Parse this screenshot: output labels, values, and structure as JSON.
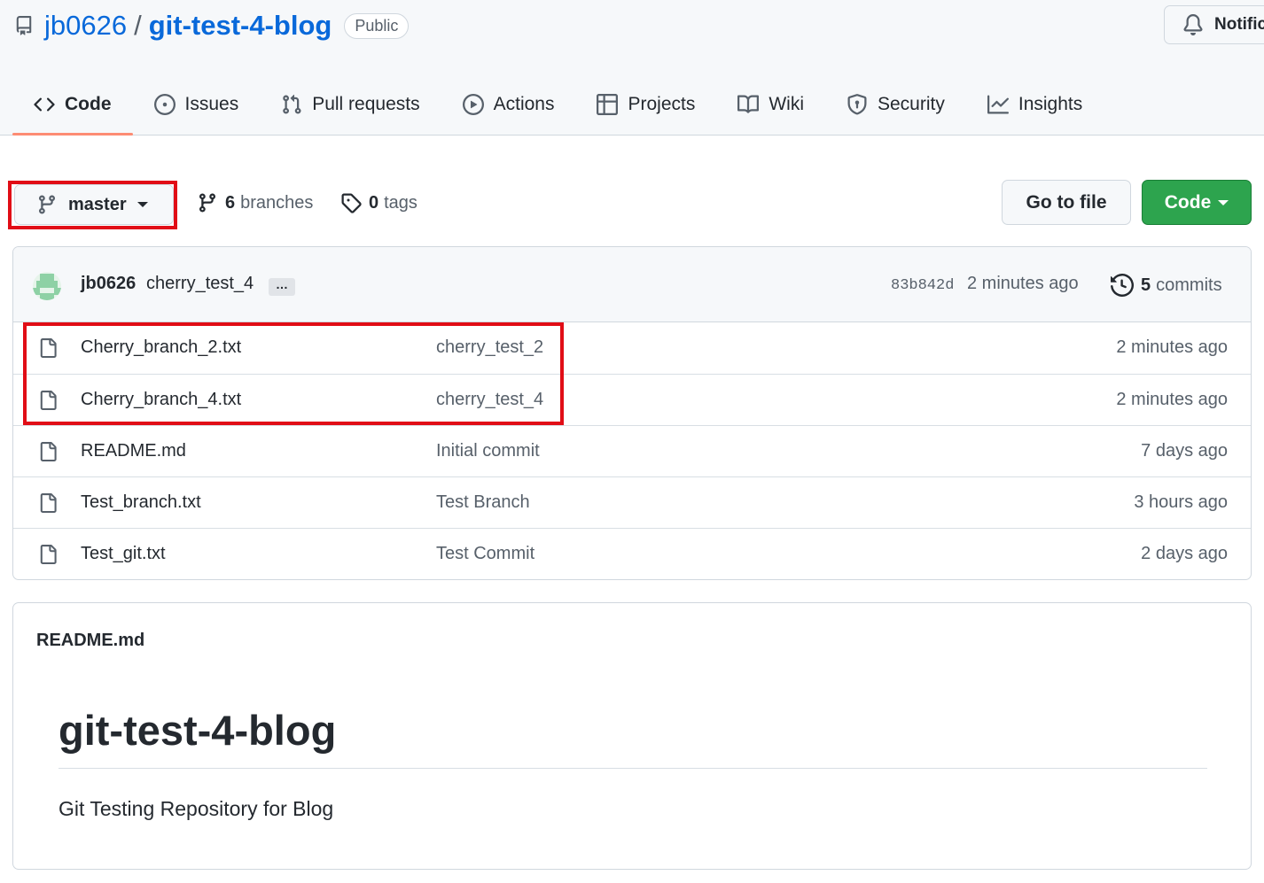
{
  "repo": {
    "owner": "jb0626",
    "separator": "/",
    "name": "git-test-4-blog",
    "visibility": "Public"
  },
  "header": {
    "notifications_label": "Notific"
  },
  "tabs": [
    {
      "label": "Code",
      "icon": "code-icon",
      "active": true
    },
    {
      "label": "Issues",
      "icon": "issue-circle-icon"
    },
    {
      "label": "Pull requests",
      "icon": "pull-request-icon"
    },
    {
      "label": "Actions",
      "icon": "play-circle-icon"
    },
    {
      "label": "Projects",
      "icon": "table-icon"
    },
    {
      "label": "Wiki",
      "icon": "book-icon"
    },
    {
      "label": "Security",
      "icon": "shield-icon"
    },
    {
      "label": "Insights",
      "icon": "graph-icon"
    }
  ],
  "toolbar": {
    "branch": "master",
    "branches_count": "6",
    "branches_label": "branches",
    "tags_count": "0",
    "tags_label": "tags",
    "go_to_file": "Go to file",
    "code_button": "Code"
  },
  "latest_commit": {
    "author": "jb0626",
    "message": "cherry_test_4",
    "more": "…",
    "sha": "83b842d",
    "time": "2 minutes ago",
    "commits_count": "5",
    "commits_label": "commits"
  },
  "files": [
    {
      "name": "Cherry_branch_2.txt",
      "message": "cherry_test_2",
      "age": "2 minutes ago"
    },
    {
      "name": "Cherry_branch_4.txt",
      "message": "cherry_test_4",
      "age": "2 minutes ago"
    },
    {
      "name": "README.md",
      "message": "Initial commit",
      "age": "7 days ago"
    },
    {
      "name": "Test_branch.txt",
      "message": "Test Branch",
      "age": "3 hours ago"
    },
    {
      "name": "Test_git.txt",
      "message": "Test Commit",
      "age": "2 days ago"
    }
  ],
  "readme": {
    "filename": "README.md",
    "heading": "git-test-4-blog",
    "body": "Git Testing Repository for Blog"
  },
  "colors": {
    "link": "#0969da",
    "tab_underline": "#fd8c73",
    "primary_button": "#2da44e",
    "highlight_box": "#e10d16"
  }
}
